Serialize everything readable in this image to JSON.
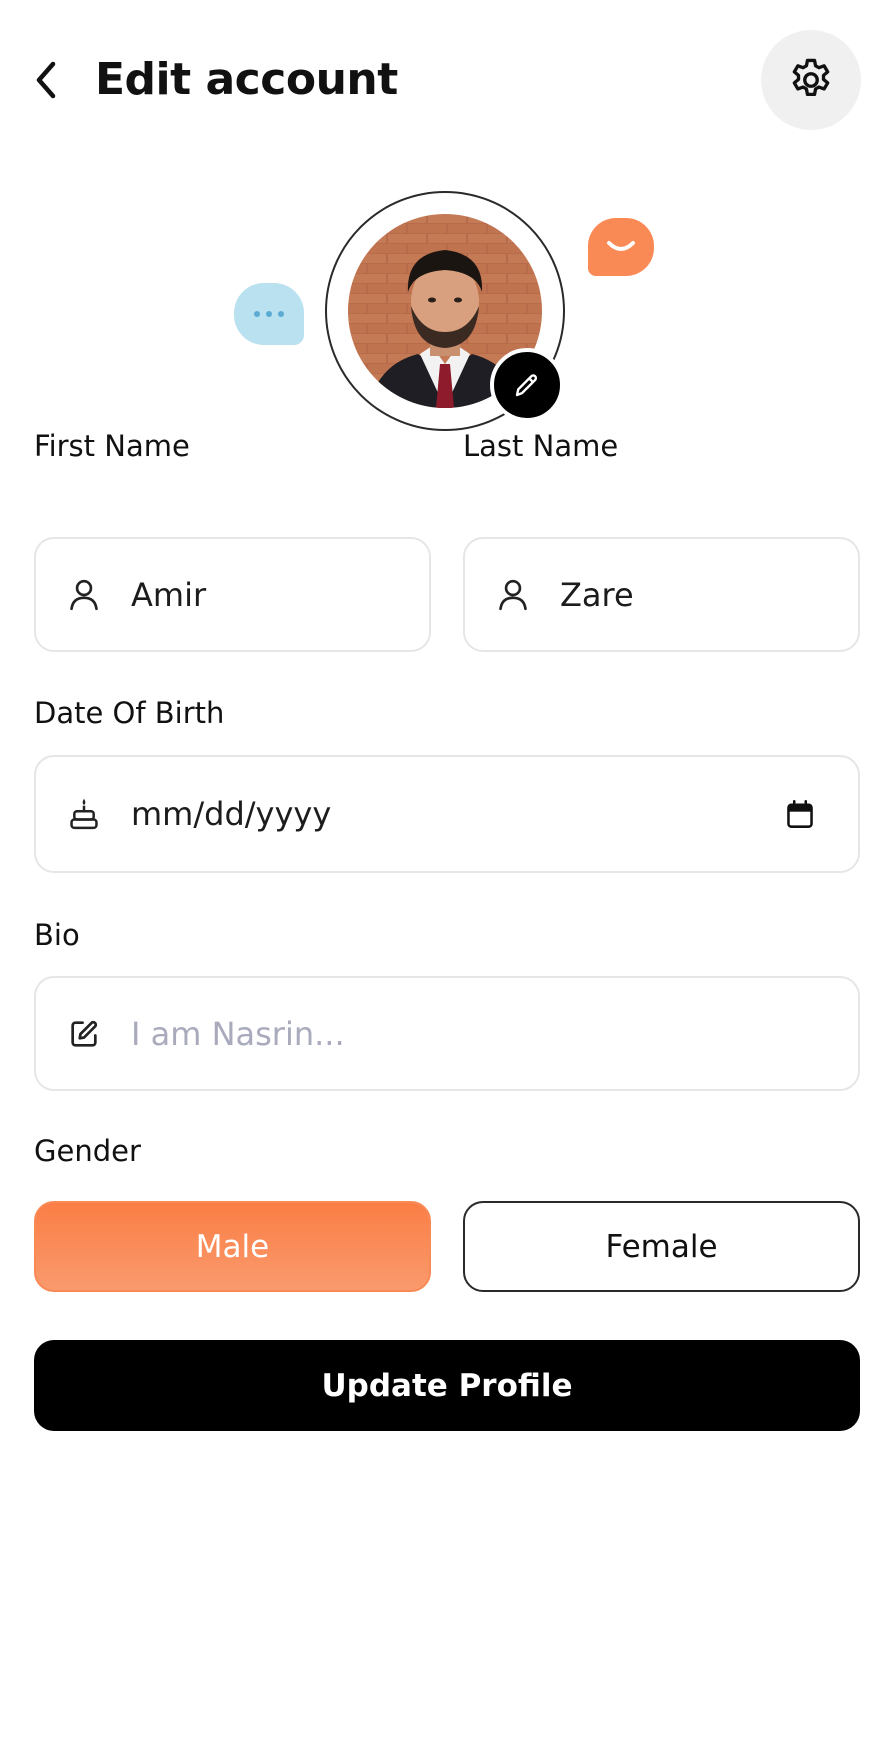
{
  "header": {
    "title": "Edit account"
  },
  "form": {
    "first_name": {
      "label": "First Name",
      "value": "Amir"
    },
    "last_name": {
      "label": "Last Name",
      "value": "Zare"
    },
    "date_of_birth": {
      "label": "Date Of Birth",
      "placeholder": "mm/dd/yyyy"
    },
    "bio": {
      "label": "Bio",
      "placeholder": "I am Nasrin..."
    },
    "gender": {
      "label": "Gender",
      "options": [
        "Male",
        "Female"
      ],
      "selected": "Male"
    },
    "submit_label": "Update Profile"
  },
  "icons": {
    "back": "chevron-left-icon",
    "settings": "gear-icon",
    "edit_photo": "pencil-icon",
    "name_field": "user-icon",
    "dob_field": "cake-icon",
    "calendar": "calendar-icon",
    "bio_field": "edit-icon"
  },
  "colors": {
    "accent": "#f98a55",
    "primary_button": "#000000",
    "bubble_blue": "#b9e1ef",
    "bubble_orange": "#f98a55",
    "placeholder": "#a9abbd"
  }
}
